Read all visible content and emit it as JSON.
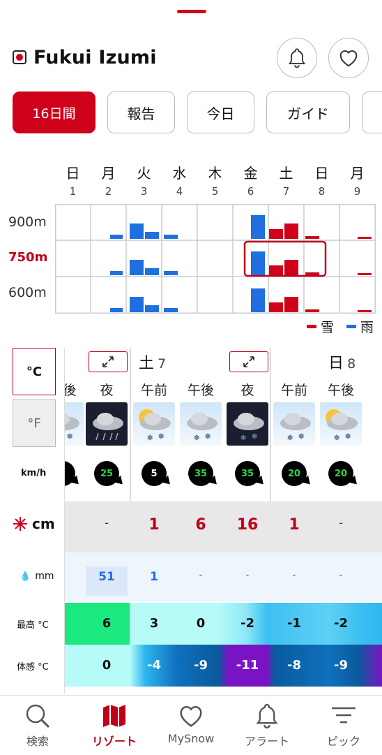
{
  "header": {
    "title": "Fukui Izumi"
  },
  "tabs": [
    {
      "label": "16日間",
      "active": true
    },
    {
      "label": "報告"
    },
    {
      "label": "今日"
    },
    {
      "label": "ガイド"
    },
    {
      "label": "..."
    }
  ],
  "days": [
    {
      "name": "日",
      "num": "1"
    },
    {
      "name": "月",
      "num": "2"
    },
    {
      "name": "火",
      "num": "3"
    },
    {
      "name": "水",
      "num": "4"
    },
    {
      "name": "木",
      "num": "5"
    },
    {
      "name": "金",
      "num": "6"
    },
    {
      "name": "土",
      "num": "7"
    },
    {
      "name": "日",
      "num": "8"
    },
    {
      "name": "月",
      "num": "9"
    }
  ],
  "altitudes": [
    "900m",
    "750m",
    "600m"
  ],
  "legend": {
    "snow": "雪",
    "rain": "雨",
    "snow_color": "#d0021b",
    "rain_color": "#1f6fe0"
  },
  "units": {
    "celsius": "°C",
    "fahrenheit": "°F",
    "wind": "km/h",
    "snow": "cm",
    "rain": "mm"
  },
  "forecast": {
    "day7_label": "土",
    "day7_num": "7",
    "day8_label": "日",
    "day8_num": "8",
    "periods": [
      "後",
      "夜",
      "午前",
      "午後",
      "夜",
      "午前",
      "午後"
    ],
    "wind": [
      "",
      "25",
      "5",
      "35",
      "35",
      "20",
      "20"
    ],
    "snow": [
      "",
      "-",
      "1",
      "6",
      "16",
      "1",
      "-"
    ],
    "rain": [
      "",
      "51",
      "1",
      "-",
      "-",
      "-",
      "-"
    ],
    "max_label": "最高 °C",
    "max": [
      "",
      "6",
      "3",
      "0",
      "-2",
      "-1",
      "-2"
    ],
    "feel_label": "体感 °C",
    "feel": [
      "",
      "0",
      "-4",
      "-9",
      "-11",
      "-8",
      "-9"
    ]
  },
  "nav": [
    {
      "label": "検索",
      "icon": "search-icon"
    },
    {
      "label": "リゾート",
      "icon": "map-icon",
      "active": true
    },
    {
      "label": "MySnow",
      "icon": "heart-icon"
    },
    {
      "label": "アラート",
      "icon": "bell-icon"
    },
    {
      "label": "ピック",
      "icon": "filter-icon"
    }
  ]
}
